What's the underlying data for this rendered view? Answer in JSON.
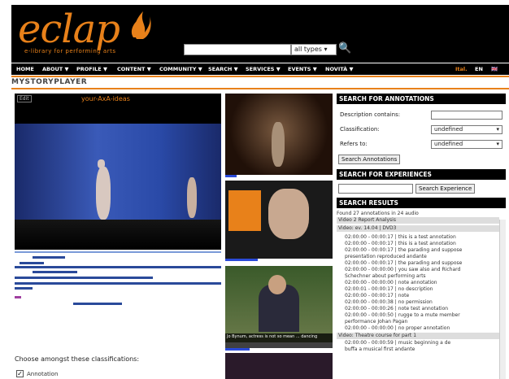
{
  "header": {
    "logo": "eclap",
    "logo_sub": "e-library for performing arts",
    "search_placeholder": "",
    "search_type": "all types",
    "search_icon": "magnifier-icon"
  },
  "nav": {
    "items": [
      "HOME",
      "ABOUT ▼",
      "PROFILE ▼",
      "CONTENT ▼",
      "COMMUNITY ▼",
      "SEARCH ▼",
      "SERVICES ▼",
      "EVENTS ▼",
      "NOVITÀ ▼"
    ],
    "right": [
      "Ital.",
      "EN",
      "▼"
    ]
  },
  "page": {
    "title": "MYSTORYPLAYER"
  },
  "video": {
    "title": "your-AxA-ideas",
    "corner": "Edit"
  },
  "classification": {
    "prompt": "Choose amongst these classifications:",
    "option1": "Annotation"
  },
  "sidebar": {
    "annotations": {
      "heading": "SEARCH FOR ANNOTATIONS",
      "desc_label": "Description contains:",
      "class_label": "Classification:",
      "class_value": "undefined",
      "refers_label": "Refers to:",
      "refers_value": "undefined",
      "button": "Search Annotations"
    },
    "experiences": {
      "heading": "SEARCH FOR EXPERIENCES",
      "button": "Search Experience"
    },
    "results": {
      "heading": "SEARCH RESULTS",
      "summary": "Found 27 annotations in 24 audio",
      "bands": [
        "Video 2 Report Analysis",
        "Video: ev. 14.04 | DVD3",
        "Video: Theatre course for part 1"
      ],
      "lines": [
        "02:00:00 - 00:00:17 | this is a test annotation",
        "02:00:00 - 00:00:17 | this is a test annotation",
        "02:00:00 - 00:00:17 | the parading and suppose",
        "presentation reproduced andante",
        "02:00:00 - 00:00:17 | the parading and suppose",
        "02:00:00 - 00:00:00 | you saw also and Richard",
        "Schechner about performing arts",
        "02:00:00 - 00:00:00 | note annotation",
        "02:00:01 - 00:00:17 | no description",
        "02:00:00 - 00:00:17 | note",
        "02:00:00 - 00:00:38 | no permission",
        "02:00:00 - 00:00:26 | note test annotation",
        "02:00:00 - 00:00:50 | rugge to a mute member",
        "performance Johan Pagan",
        "02:00:00 - 00:00:00 | no proper annotation",
        "02:00:00 - 00:00:59 | music beginning a de",
        "buffa a musical first andante"
      ]
    }
  },
  "thumb_caption": "Jo Bynum, actress is not so mean ... dancing",
  "colors": {
    "accent": "#e8811a",
    "header_bg": "#000000",
    "link_blue": "#2a4ad8"
  }
}
